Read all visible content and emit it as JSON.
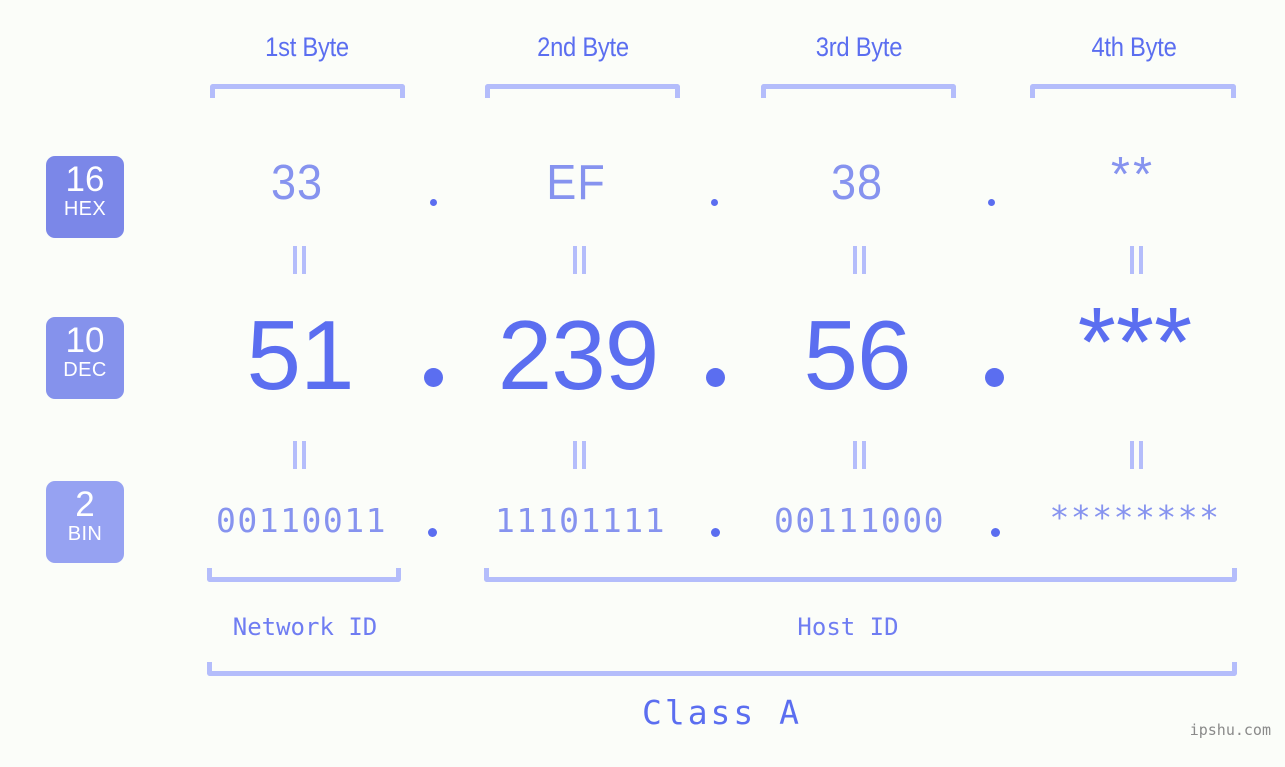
{
  "canvas": {
    "background": "#fbfdf9"
  },
  "palette": {
    "strong_blue": "#5b6ef0",
    "mid_blue": "#8693ef",
    "light_blue": "#b4bdfb",
    "badge_hex": "#7b87e8",
    "badge_dec": "#8592ec",
    "badge_bin": "#96a2f2",
    "watermark_gray": "#8a8a8a"
  },
  "headers": [
    {
      "label": "1st Byte"
    },
    {
      "label": "2nd Byte"
    },
    {
      "label": "3rd Byte"
    },
    {
      "label": "4th Byte"
    }
  ],
  "bases": [
    {
      "number": "16",
      "name": "HEX"
    },
    {
      "number": "10",
      "name": "DEC"
    },
    {
      "number": "2",
      "name": "BIN"
    }
  ],
  "rows": {
    "hex": {
      "base": "16",
      "label": "HEX",
      "bytes": [
        "33",
        "EF",
        "38",
        "**"
      ],
      "separator": "."
    },
    "dec": {
      "base": "10",
      "label": "DEC",
      "bytes": [
        "51",
        "239",
        "56",
        "***"
      ],
      "separator": "."
    },
    "bin": {
      "base": "2",
      "label": "BIN",
      "bytes": [
        "00110011",
        "11101111",
        "00111000",
        "********"
      ],
      "separator": "."
    }
  },
  "equality_marker": "||",
  "segments": {
    "network_id": {
      "label": "Network ID"
    },
    "host_id": {
      "label": "Host ID"
    },
    "class": {
      "label": "Class A"
    }
  },
  "watermark": {
    "text": "ipshu.com"
  }
}
